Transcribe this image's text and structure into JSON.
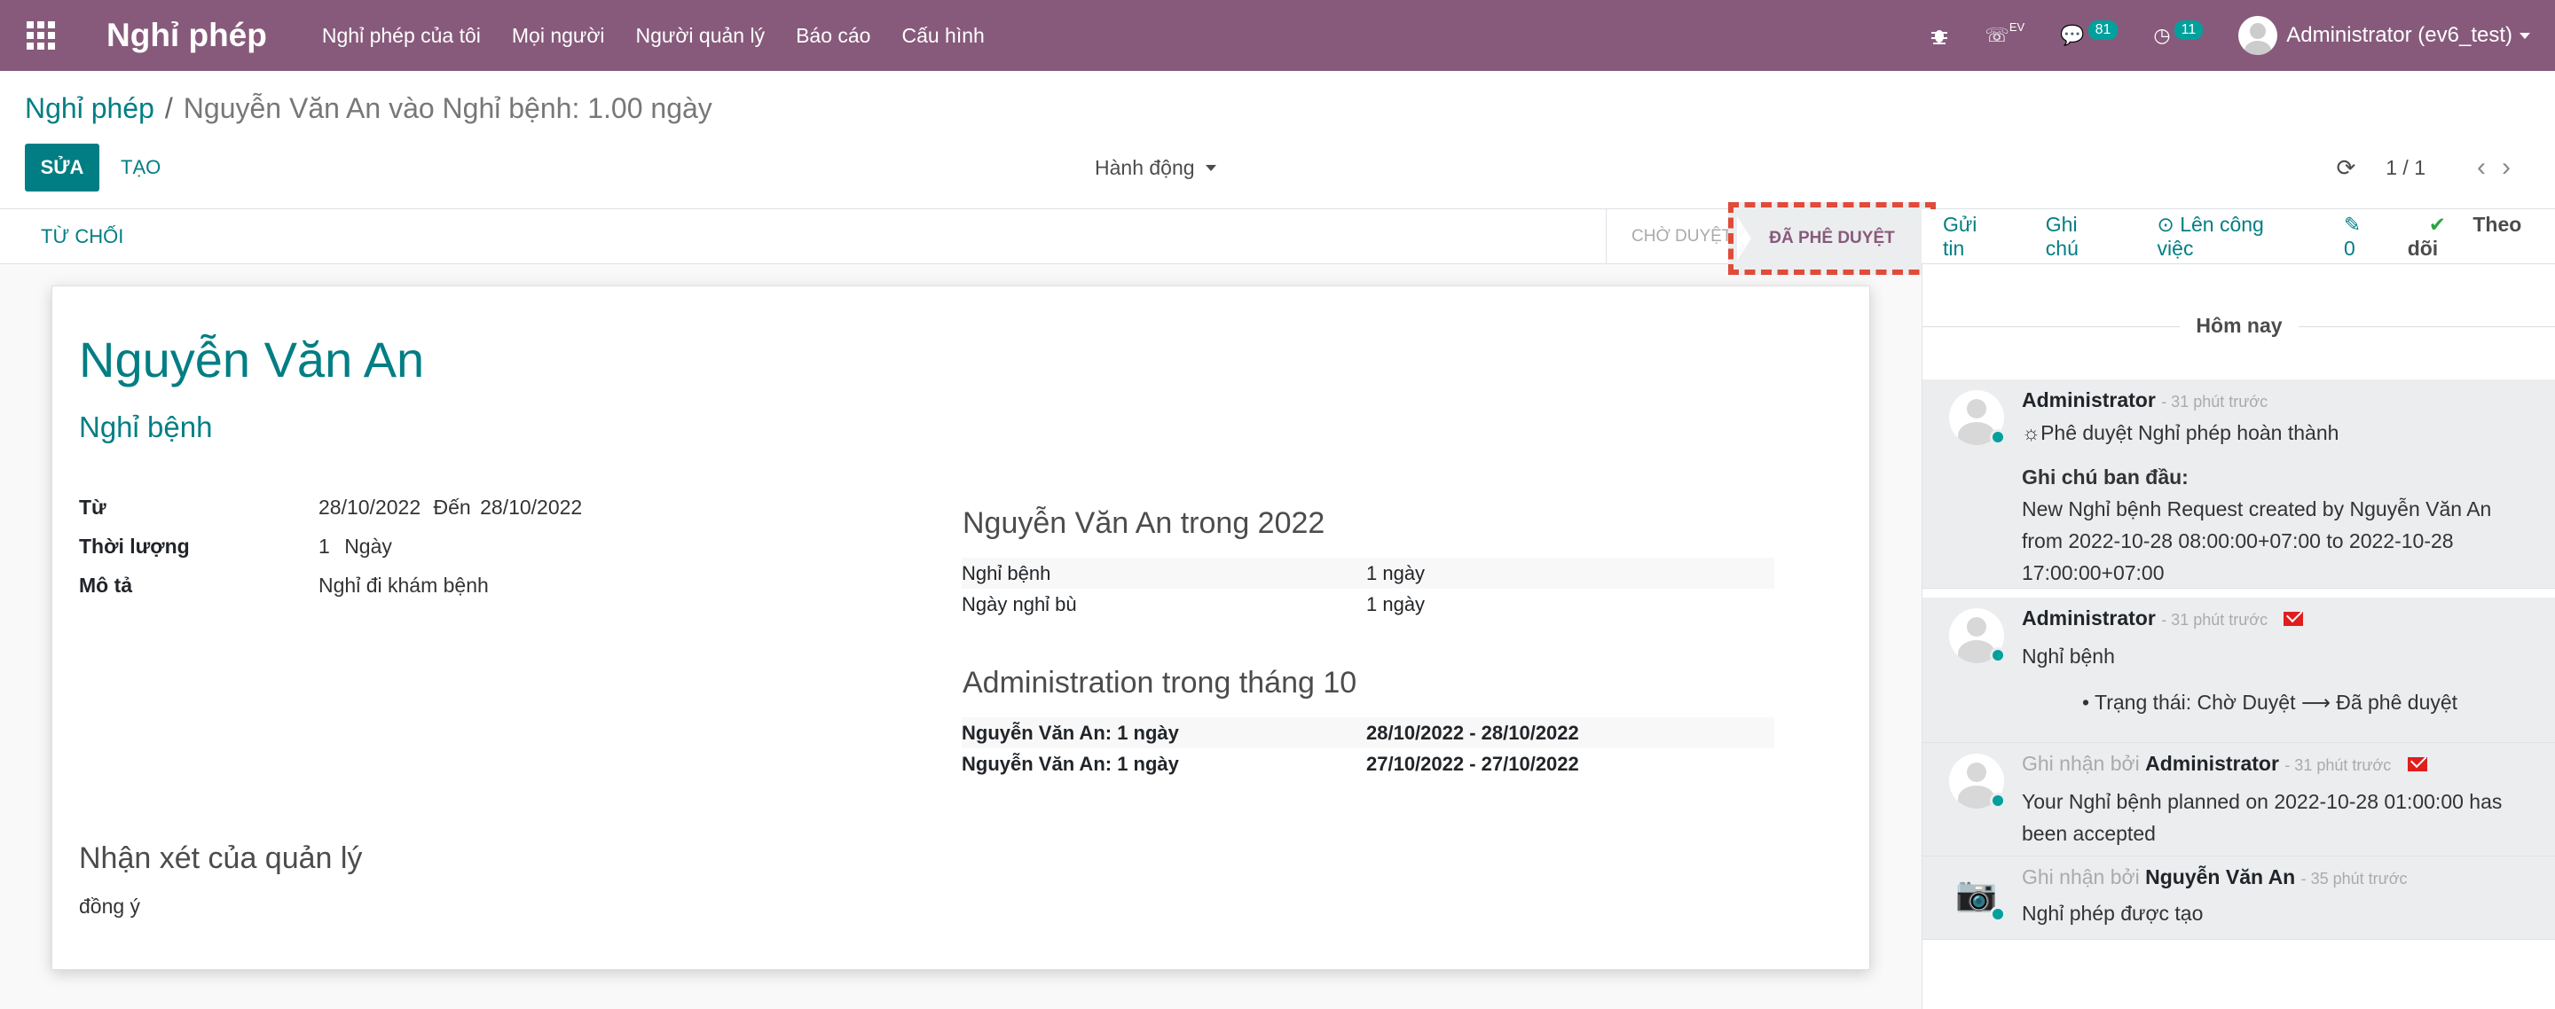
{
  "navbar": {
    "brand": "Nghỉ phép",
    "menu": [
      "Nghỉ phép của tôi",
      "Mọi người",
      "Người quản lý",
      "Báo cáo",
      "Cấu hình"
    ],
    "ev_label": "EV",
    "messages_count": "81",
    "activities_count": "11",
    "user": "Administrator (ev6_test)"
  },
  "breadcrumb": {
    "parent": "Nghỉ phép",
    "separator": "/",
    "current": "Nguyễn Văn An vào Nghỉ bệnh: 1.00 ngày"
  },
  "buttons": {
    "edit": "SỬA",
    "create": "TẠO",
    "action": "Hành động",
    "refuse": "TỪ CHỐI"
  },
  "pager": {
    "value": "1 / 1"
  },
  "status": {
    "stages": [
      "CHỜ DUYỆT",
      "ĐÃ PHÊ DUYỆT"
    ],
    "active": "ĐÃ PHÊ DUYỆT"
  },
  "chatter_top": {
    "send": "Gửi tin",
    "note": "Ghi chú",
    "activity": "⊙ Lên công việc",
    "attach": "✎ 0",
    "follow": "Theo dõi"
  },
  "form": {
    "employee": "Nguyễn Văn An",
    "leave_type": "Nghỉ bệnh",
    "from_label": "Từ",
    "from_value": "28/10/2022",
    "to_label": "Đến",
    "to_value": "28/10/2022",
    "duration_label": "Thời lượng",
    "duration_value": "1",
    "duration_unit": "Ngày",
    "desc_label": "Mô tả",
    "desc_value": "Nghỉ đi khám bệnh",
    "summary1_title": "Nguyễn Văn An trong 2022",
    "summary1_rows": [
      {
        "name": "Nghỉ bệnh",
        "value": "1 ngày"
      },
      {
        "name": "Ngày nghỉ bù",
        "value": "1 ngày"
      }
    ],
    "summary2_title": "Administration trong tháng 10",
    "summary2_rows": [
      {
        "name": "Nguyễn Văn An: 1 ngày",
        "value": "28/10/2022 - 28/10/2022"
      },
      {
        "name": "Nguyễn Văn An: 1 ngày",
        "value": "27/10/2022 - 27/10/2022"
      }
    ],
    "manager_title": "Nhận xét của quản lý",
    "manager_note": "đồng ý"
  },
  "chatter": {
    "today": "Hôm nay",
    "messages": [
      {
        "author": "Administrator",
        "time": "- 31 phút trước",
        "lines": [
          "☼Phê duyệt Nghỉ phép hoàn thành",
          "Ghi chú ban đầu:",
          "New Nghỉ bệnh Request created by Nguyễn Văn An",
          "from 2022-10-28 08:00:00+07:00 to 2022-10-28",
          "17:00:00+07:00"
        ]
      },
      {
        "author": "Administrator",
        "time": "- 31 phút trước",
        "lines": [
          "Nghỉ bệnh",
          "• Trạng thái: Chờ Duyệt ⟶ Đã phê duyệt"
        ]
      },
      {
        "prefix": "Ghi nhận bởi",
        "author": "Administrator",
        "time": "- 31 phút trước",
        "lines": [
          "Your Nghỉ bệnh planned on 2022-10-28 01:00:00 has",
          "been accepted"
        ]
      },
      {
        "prefix": "Ghi nhận bởi",
        "author": "Nguyễn Văn An",
        "time": "- 35 phút trước",
        "lines": [
          "Nghỉ phép được tạo"
        ]
      }
    ]
  },
  "colors": {
    "navbar": "#875a7b",
    "primary": "#017e84",
    "highlight": "#e04b3a"
  }
}
